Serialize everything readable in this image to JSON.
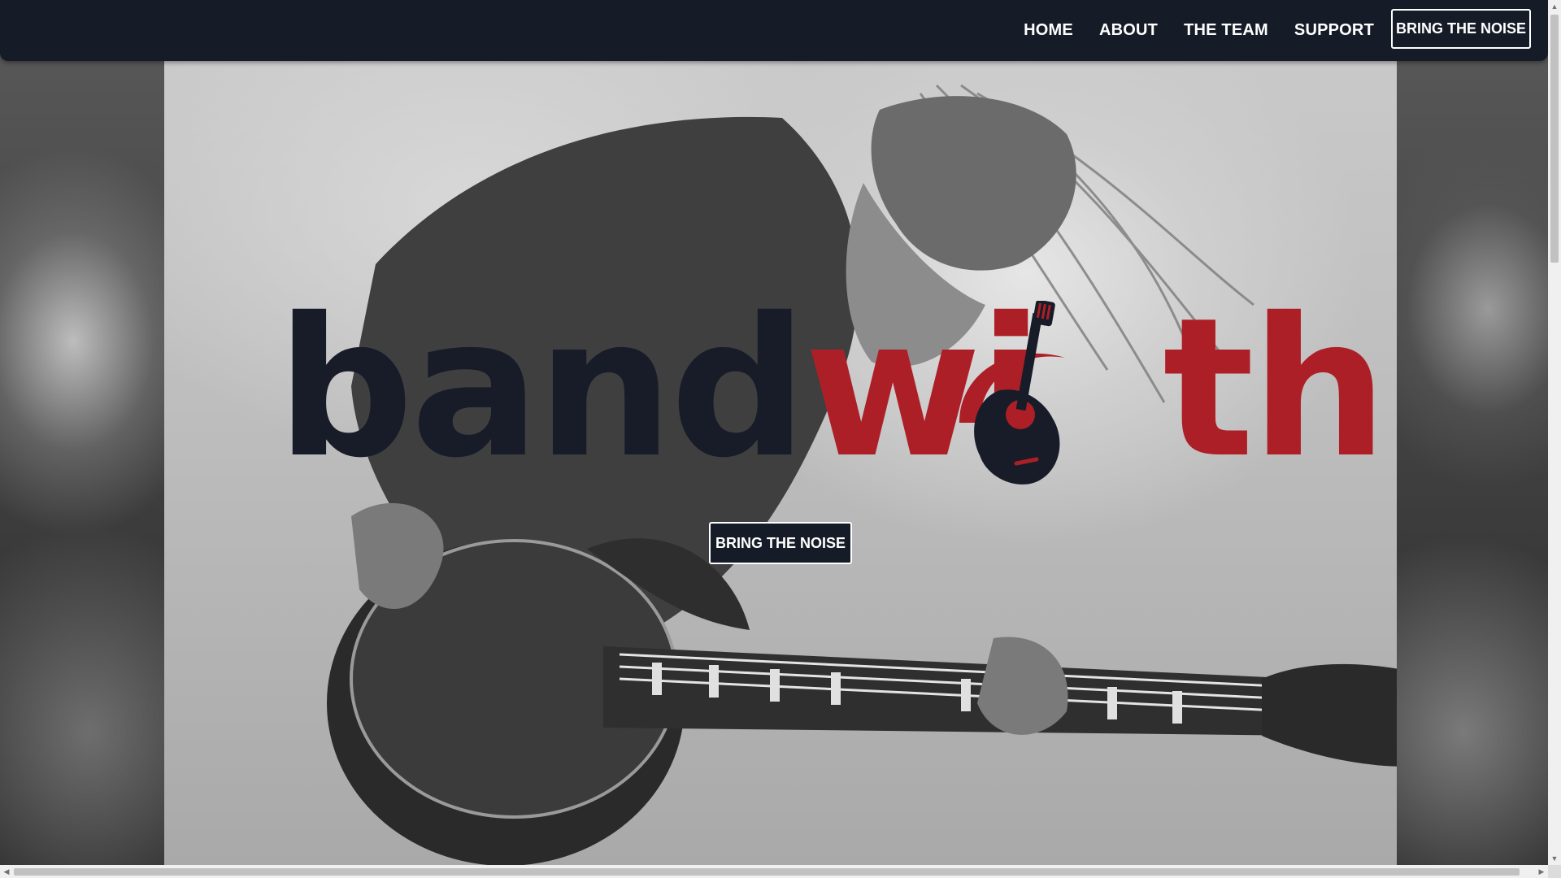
{
  "nav": {
    "items": [
      {
        "label": "HOME"
      },
      {
        "label": "ABOUT"
      },
      {
        "label": "THE TEAM"
      },
      {
        "label": "SUPPORT"
      }
    ],
    "cta_label": "BRING THE NOISE"
  },
  "hero": {
    "logo_part1": "band",
    "logo_part2": "wi",
    "logo_part3": "th",
    "cta_label": "BRING THE NOISE",
    "image_description_icon": "guitarist-photo"
  },
  "colors": {
    "nav_bg": "#161c27",
    "brand_dark": "#171c28",
    "brand_red": "#ad1f26"
  },
  "scrollbars": {
    "up_arrow": "▲",
    "down_arrow": "▼",
    "left_arrow": "◀",
    "right_arrow": "▶"
  }
}
